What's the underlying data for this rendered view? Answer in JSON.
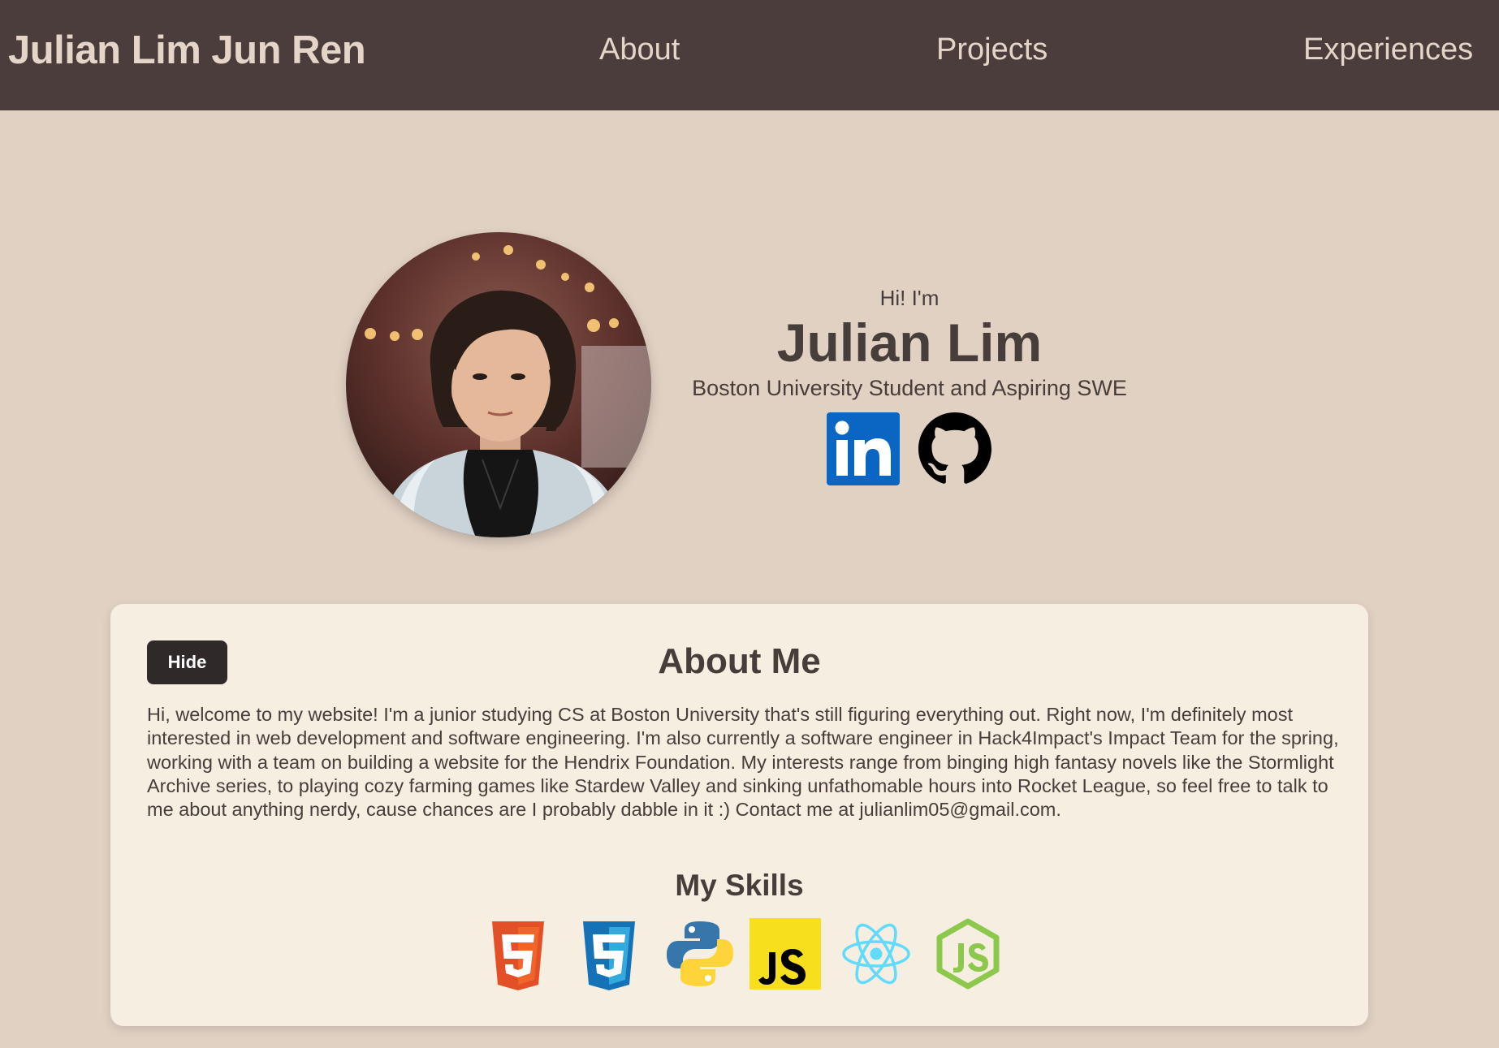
{
  "navbar": {
    "brand": "Julian Lim Jun Ren",
    "links": [
      {
        "label": "About"
      },
      {
        "label": "Projects"
      },
      {
        "label": "Experiences"
      }
    ]
  },
  "hero": {
    "greeting": "Hi! I'm",
    "name": "Julian Lim",
    "subtitle": "Boston University Student and Aspiring SWE",
    "socials": [
      {
        "icon": "linkedin-icon",
        "color": "#0a66c2"
      },
      {
        "icon": "github-icon",
        "color": "#000000"
      }
    ]
  },
  "about": {
    "hide_label": "Hide",
    "title": "About Me",
    "body": "Hi, welcome to my website! I'm a junior studying CS at Boston University that's still figuring everything out. Right now, I'm definitely most interested in web development and software engineering. I'm also currently a software engineer in Hack4Impact's Impact Team for the spring, working with a team on building a website for the Hendrix Foundation. My interests range from binging high fantasy novels like the Stormlight Archive series, to playing cozy farming games like Stardew Valley and sinking unfathomable hours into Rocket League, so feel free to talk to me about anything nerdy, cause chances are I probably dabble in it :) Contact me at julianlim05@gmail.com.",
    "skills_title": "My Skills",
    "skills": [
      {
        "icon": "html5-icon",
        "color": "#e34f26"
      },
      {
        "icon": "css3-icon",
        "color": "#1572b6"
      },
      {
        "icon": "python-icon",
        "color": "#3776ab"
      },
      {
        "icon": "javascript-icon",
        "color": "#f7df1e"
      },
      {
        "icon": "react-icon",
        "color": "#61dafb"
      },
      {
        "icon": "nodejs-icon",
        "color": "#8cc84b"
      }
    ]
  },
  "colors": {
    "navbar_bg": "#4a3d3b",
    "page_bg": "#e1d1c3",
    "card_bg": "#f5eee1",
    "text": "#473d3a",
    "nav_text": "#e5d5c8"
  }
}
